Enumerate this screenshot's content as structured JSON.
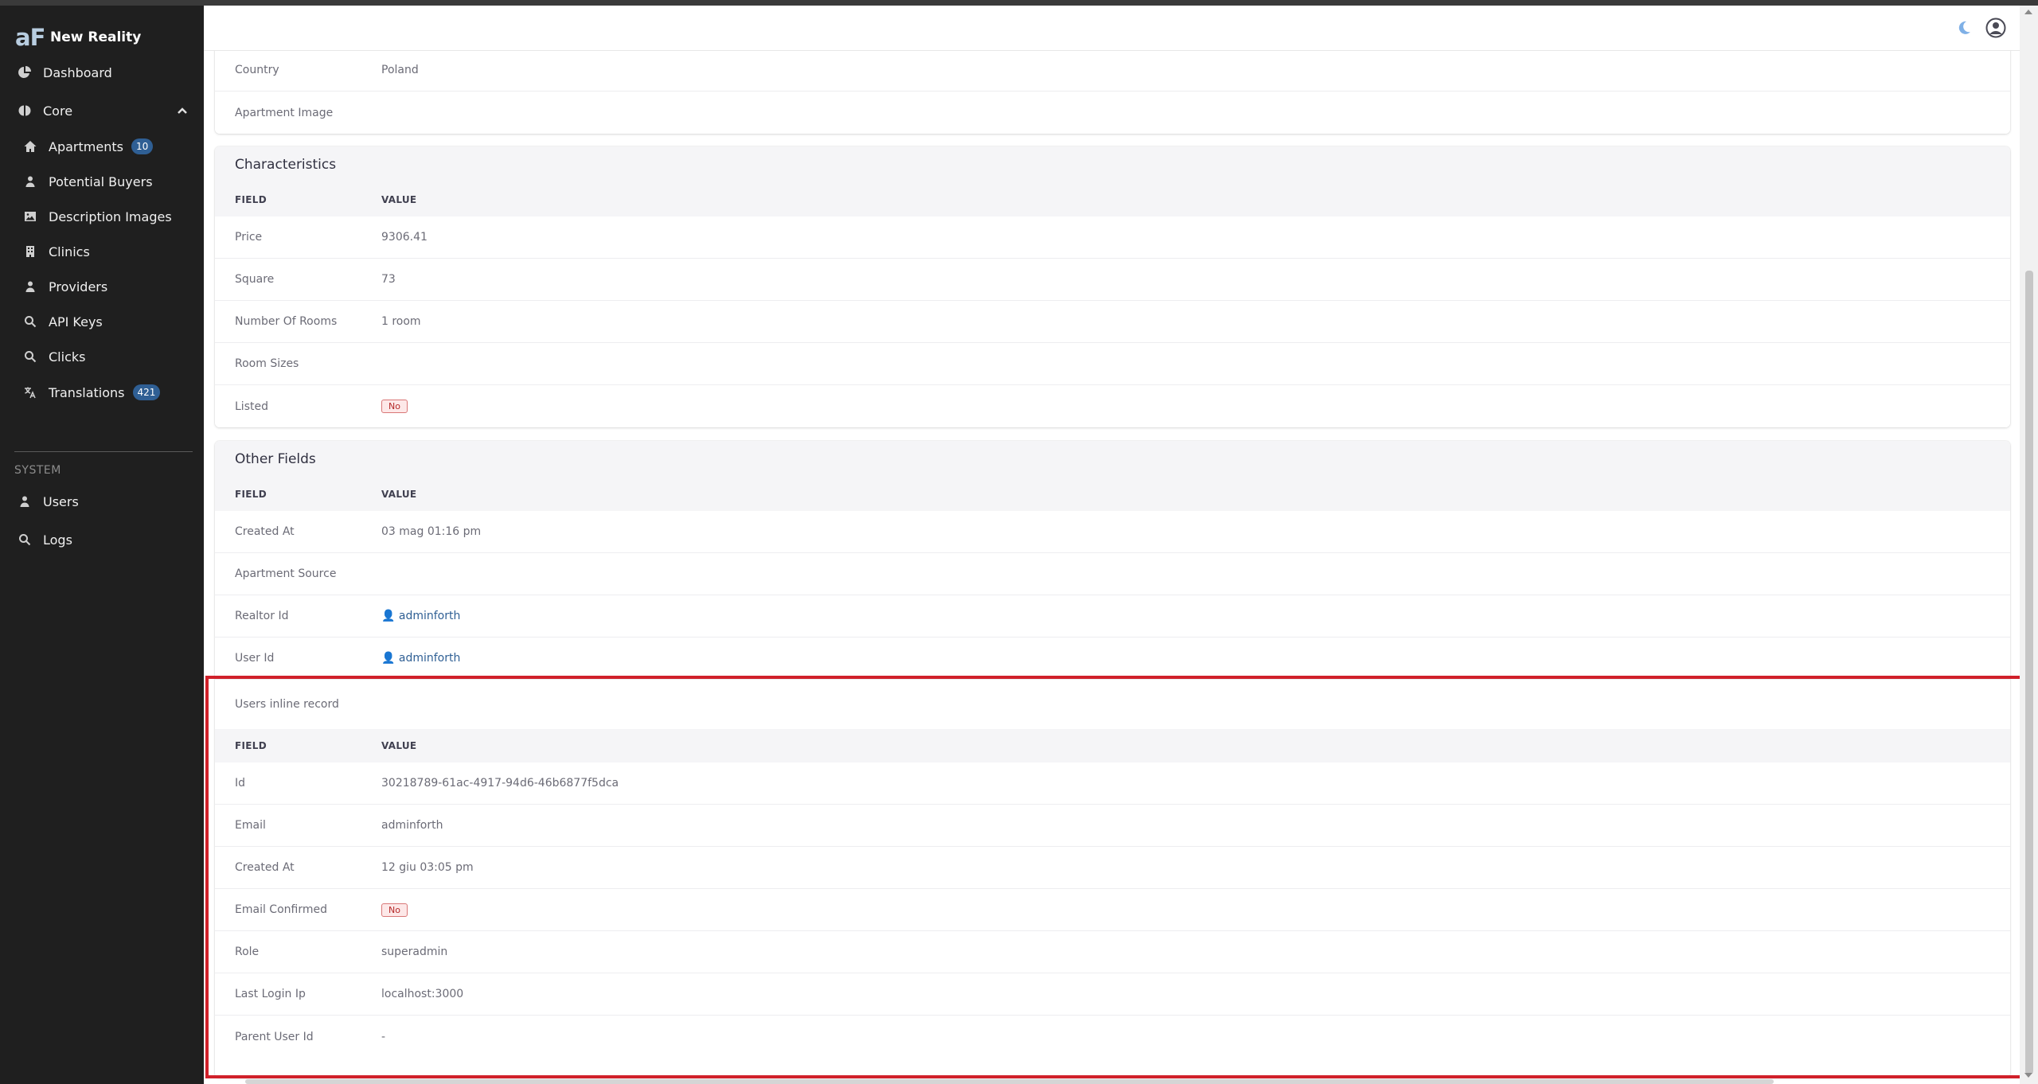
{
  "brand": {
    "logo": "aF",
    "name": "New Reality"
  },
  "sidebar": {
    "dashboard": {
      "label": "Dashboard",
      "icon": "pie-chart-icon"
    },
    "core": {
      "label": "Core",
      "icon": "core-icon",
      "expanded": true
    },
    "items": [
      {
        "label": "Apartments",
        "badge": "10",
        "icon": "home-icon"
      },
      {
        "label": "Potential Buyers",
        "icon": "user-icon"
      },
      {
        "label": "Description Images",
        "icon": "image-icon"
      },
      {
        "label": "Clinics",
        "icon": "building-icon"
      },
      {
        "label": "Providers",
        "icon": "user-icon"
      },
      {
        "label": "API Keys",
        "icon": "search-icon"
      },
      {
        "label": "Clicks",
        "icon": "search-icon"
      },
      {
        "label": "Translations",
        "badge": "421",
        "icon": "translate-icon"
      }
    ],
    "system_label": "SYSTEM",
    "system_items": [
      {
        "label": "Users",
        "icon": "user-icon"
      },
      {
        "label": "Logs",
        "icon": "search-icon"
      }
    ]
  },
  "topbar": {
    "theme_icon": "moon-icon",
    "account_icon": "user-circle-icon"
  },
  "top_card": {
    "rows": [
      {
        "field": "Country",
        "value": "Poland"
      },
      {
        "field": "Apartment Image",
        "value": ""
      }
    ]
  },
  "characteristics": {
    "title": "Characteristics",
    "col_field": "FIELD",
    "col_value": "VALUE",
    "rows": [
      {
        "field": "Price",
        "value": "9306.41"
      },
      {
        "field": "Square",
        "value": "73"
      },
      {
        "field": "Number Of Rooms",
        "value": "1 room"
      },
      {
        "field": "Room Sizes",
        "value": ""
      },
      {
        "field": "Listed",
        "value": "No"
      }
    ]
  },
  "other_fields": {
    "title": "Other Fields",
    "col_field": "FIELD",
    "col_value": "VALUE",
    "rows": [
      {
        "field": "Created At",
        "value": "03 mag 01:16 pm"
      },
      {
        "field": "Apartment Source",
        "value": ""
      },
      {
        "field": "Realtor Id",
        "value": "adminforth"
      },
      {
        "field": "User Id",
        "value": "adminforth"
      }
    ],
    "inline": {
      "title": "Users inline record",
      "col_field": "FIELD",
      "col_value": "VALUE",
      "rows": [
        {
          "field": "Id",
          "value": "30218789-61ac-4917-94d6-46b6877f5dca"
        },
        {
          "field": "Email",
          "value": "adminforth"
        },
        {
          "field": "Created At",
          "value": "12 giu 03:05 pm"
        },
        {
          "field": "Email Confirmed",
          "value": "No"
        },
        {
          "field": "Role",
          "value": "superadmin"
        },
        {
          "field": "Last Login Ip",
          "value": "localhost:3000"
        },
        {
          "field": "Parent User Id",
          "value": "-"
        }
      ]
    }
  },
  "colors": {
    "sidebar_bg": "#1f1f1f",
    "badge_bg": "#2f5f94",
    "highlight": "#d0202a",
    "link": "#2f5f94"
  }
}
